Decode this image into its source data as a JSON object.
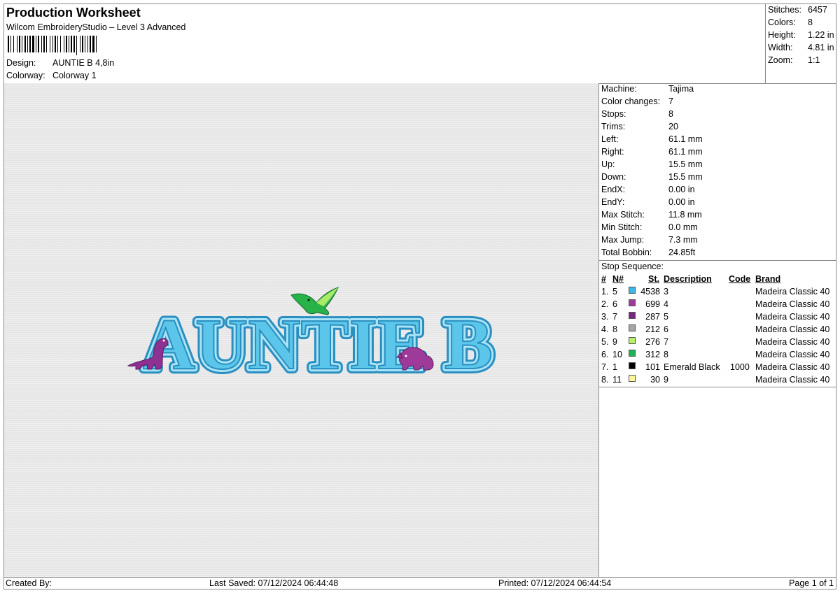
{
  "header": {
    "title": "Production Worksheet",
    "software": "Wilcom EmbroideryStudio – Level 3 Advanced",
    "design_label": "Design:",
    "design_value": "AUNTIE B 4,8in",
    "colorway_label": "Colorway:",
    "colorway_value": "Colorway 1"
  },
  "summary": [
    {
      "label": "Stitches:",
      "value": "6457"
    },
    {
      "label": "Colors:",
      "value": "8"
    },
    {
      "label": "Height:",
      "value": "1.22 in"
    },
    {
      "label": "Width:",
      "value": "4.81 in"
    },
    {
      "label": "Zoom:",
      "value": "1:1"
    }
  ],
  "machine_info": [
    {
      "label": "Machine:",
      "value": "Tajima"
    },
    {
      "label": "Color changes:",
      "value": "7"
    },
    {
      "label": "Stops:",
      "value": "8"
    },
    {
      "label": "Trims:",
      "value": "20"
    },
    {
      "label": "Left:",
      "value": "61.1 mm"
    },
    {
      "label": "Right:",
      "value": "61.1 mm"
    },
    {
      "label": "Up:",
      "value": "15.5 mm"
    },
    {
      "label": "Down:",
      "value": "15.5 mm"
    },
    {
      "label": "EndX:",
      "value": "0.00 in"
    },
    {
      "label": "EndY:",
      "value": "0.00 in"
    },
    {
      "label": "Max Stitch:",
      "value": "11.8 mm"
    },
    {
      "label": "Min Stitch:",
      "value": "0.0 mm"
    },
    {
      "label": "Max Jump:",
      "value": "7.3 mm"
    },
    {
      "label": "Total Bobbin:",
      "value": "24.85ft"
    }
  ],
  "stop_sequence": {
    "label": "Stop Sequence:",
    "headers": {
      "num": "#",
      "n": "N#",
      "st": "St.",
      "desc": "Description",
      "code": "Code",
      "brand": "Brand"
    },
    "rows": [
      {
        "num": "1.",
        "n": "5",
        "color": "#3fb6e8",
        "st": "4538",
        "desc": "3",
        "code": "",
        "brand": "Madeira Classic 40"
      },
      {
        "num": "2.",
        "n": "6",
        "color": "#a0399a",
        "st": "699",
        "desc": "4",
        "code": "",
        "brand": "Madeira Classic 40"
      },
      {
        "num": "3.",
        "n": "7",
        "color": "#7b2682",
        "st": "287",
        "desc": "5",
        "code": "",
        "brand": "Madeira Classic 40"
      },
      {
        "num": "4.",
        "n": "8",
        "color": "#a6a6a6",
        "st": "212",
        "desc": "6",
        "code": "",
        "brand": "Madeira Classic 40"
      },
      {
        "num": "5.",
        "n": "9",
        "color": "#b8f06a",
        "st": "276",
        "desc": "7",
        "code": "",
        "brand": "Madeira Classic 40"
      },
      {
        "num": "6.",
        "n": "10",
        "color": "#1fb358",
        "st": "312",
        "desc": "8",
        "code": "",
        "brand": "Madeira Classic 40"
      },
      {
        "num": "7.",
        "n": "1",
        "color": "#000000",
        "st": "101",
        "desc": "Emerald Black",
        "code": "1000",
        "brand": "Madeira Classic 40"
      },
      {
        "num": "8.",
        "n": "11",
        "color": "#fff59a",
        "st": "30",
        "desc": "9",
        "code": "",
        "brand": "Madeira Classic 40"
      }
    ]
  },
  "design_preview": {
    "text": "AUNTIE B",
    "text_color": "#5cc6ea",
    "outline_color": "#2a8fc0"
  },
  "footer": {
    "created_by": "Created By:",
    "last_saved": "Last Saved: 07/12/2024 06:44:48",
    "printed": "Printed: 07/12/2024 06:44:54",
    "page": "Page 1 of 1"
  }
}
